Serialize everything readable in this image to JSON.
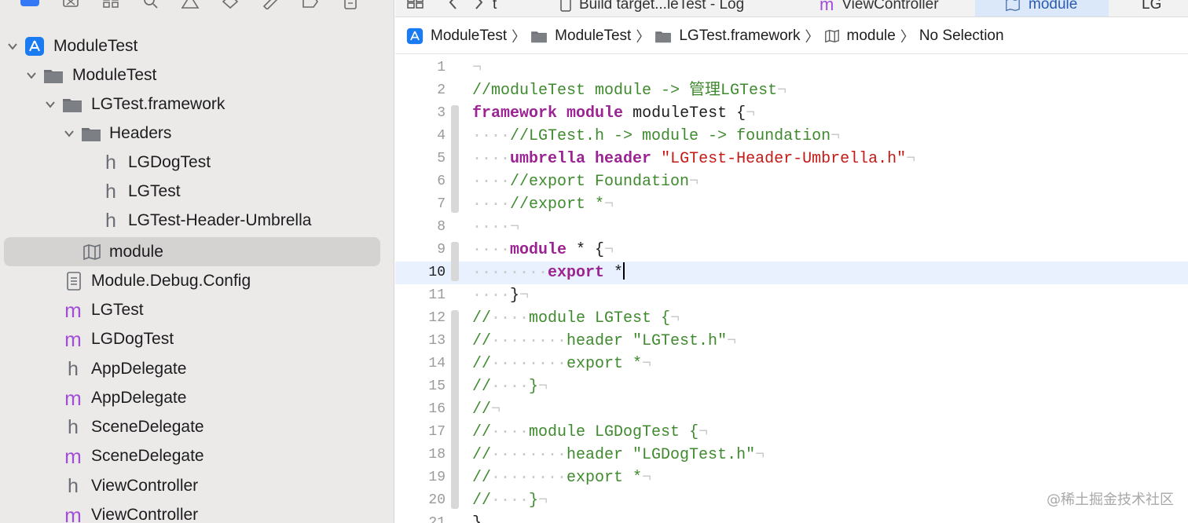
{
  "sidebar": {
    "items": [
      {
        "label": "ModuleTest",
        "icon": "app-project-icon",
        "disclosure": "expanded"
      },
      {
        "label": "ModuleTest",
        "icon": "folder-icon",
        "disclosure": "expanded"
      },
      {
        "label": "LGTest.framework",
        "icon": "folder-icon",
        "disclosure": "expanded"
      },
      {
        "label": "Headers",
        "icon": "folder-icon",
        "disclosure": "expanded"
      },
      {
        "label": "LGDogTest",
        "icon": "header-file-icon",
        "glyph": "h"
      },
      {
        "label": "LGTest",
        "icon": "header-file-icon",
        "glyph": "h"
      },
      {
        "label": "LGTest-Header-Umbrella",
        "icon": "header-file-icon",
        "glyph": "h"
      },
      {
        "label": "module",
        "icon": "modulemap-icon",
        "selected": true
      },
      {
        "label": "Module.Debug.Config",
        "icon": "config-file-icon"
      },
      {
        "label": "LGTest",
        "icon": "objc-file-icon",
        "glyph": "m"
      },
      {
        "label": "LGDogTest",
        "icon": "objc-file-icon",
        "glyph": "m"
      },
      {
        "label": "AppDelegate",
        "icon": "header-file-icon",
        "glyph": "h"
      },
      {
        "label": "AppDelegate",
        "icon": "objc-file-icon",
        "glyph": "m"
      },
      {
        "label": "SceneDelegate",
        "icon": "header-file-icon",
        "glyph": "h"
      },
      {
        "label": "SceneDelegate",
        "icon": "objc-file-icon",
        "glyph": "m"
      },
      {
        "label": "ViewController",
        "icon": "header-file-icon",
        "glyph": "h"
      },
      {
        "label": "ViewController",
        "icon": "objc-file-icon",
        "glyph": "m"
      }
    ]
  },
  "tabs": [
    {
      "label": "t"
    },
    {
      "label": "Build target...leTest - Log"
    },
    {
      "label": "ViewController"
    },
    {
      "label": "module",
      "active": true
    },
    {
      "label": "LG"
    }
  ],
  "breadcrumb": {
    "items": [
      "ModuleTest",
      "ModuleTest",
      "LGTest.framework",
      "module",
      "No Selection"
    ]
  },
  "editor": {
    "current_line": 10,
    "lines": [
      {
        "n": "1",
        "text": "¬"
      },
      {
        "n": "2",
        "text": "//moduleTest module -> 管理LGTest¬"
      },
      {
        "n": "3",
        "text": "framework module moduleTest {¬"
      },
      {
        "n": "4",
        "text": "····//LGTest.h -> module -> foundation¬"
      },
      {
        "n": "5",
        "text": "····umbrella header \"LGTest-Header-Umbrella.h\"¬"
      },
      {
        "n": "6",
        "text": "····//export Foundation¬"
      },
      {
        "n": "7",
        "text": "····//export *¬"
      },
      {
        "n": "8",
        "text": "····¬"
      },
      {
        "n": "9",
        "text": "····module * {¬"
      },
      {
        "n": "10",
        "text": "········export *"
      },
      {
        "n": "11",
        "text": "····}¬"
      },
      {
        "n": "12",
        "text": "//····module LGTest {¬"
      },
      {
        "n": "13",
        "text": "//········header \"LGTest.h\"¬"
      },
      {
        "n": "14",
        "text": "//········export *¬"
      },
      {
        "n": "15",
        "text": "//····}¬"
      },
      {
        "n": "16",
        "text": "//¬"
      },
      {
        "n": "17",
        "text": "//····module LGDogTest {¬"
      },
      {
        "n": "18",
        "text": "//········header \"LGDogTest.h\"¬"
      },
      {
        "n": "19",
        "text": "//········export *¬"
      },
      {
        "n": "20",
        "text": "//····}¬"
      },
      {
        "n": "21",
        "text": "}"
      }
    ]
  },
  "watermark": "@稀土掘金技术社区",
  "colors": {
    "comment": "#3f8a2e",
    "keyword": "#9b2393",
    "string": "#c41a16",
    "selection": "#d4d3d2",
    "current_line": "#e8f1fd",
    "objc_m": "#a24dd6"
  }
}
